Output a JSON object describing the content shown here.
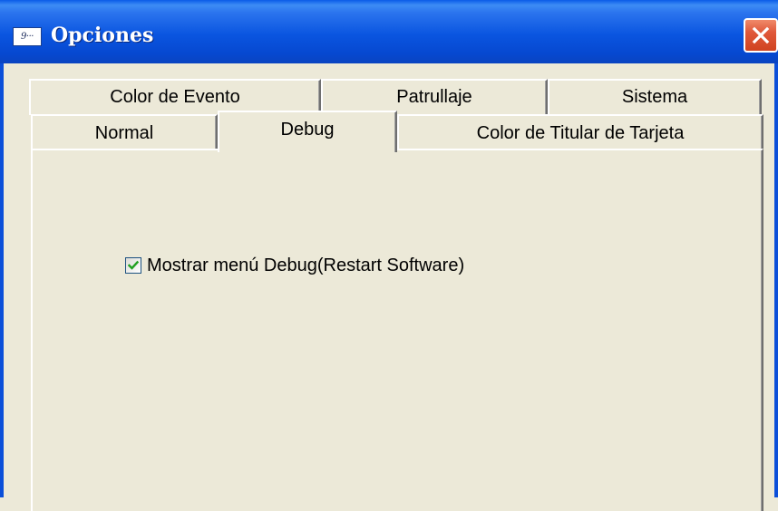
{
  "window": {
    "title": "Opciones",
    "icon_text": "9···"
  },
  "tabs": {
    "row1": [
      {
        "label": "Color de Evento"
      },
      {
        "label": "Patrullaje"
      },
      {
        "label": "Sistema"
      }
    ],
    "row2": [
      {
        "label": "Normal"
      },
      {
        "label": "Debug",
        "active": true
      },
      {
        "label": "Color de Titular de Tarjeta"
      }
    ]
  },
  "debug_panel": {
    "show_debug_menu": {
      "label": "Mostrar menú Debug(Restart Software)",
      "checked": true
    }
  },
  "colors": {
    "titlebar": "#0a55e0",
    "window_bg": "#ece9d8",
    "close_button": "#e0583a",
    "checkmark": "#21a121"
  },
  "icons": {
    "app": "app-icon",
    "close": "close-icon",
    "check": "checkmark-icon"
  }
}
